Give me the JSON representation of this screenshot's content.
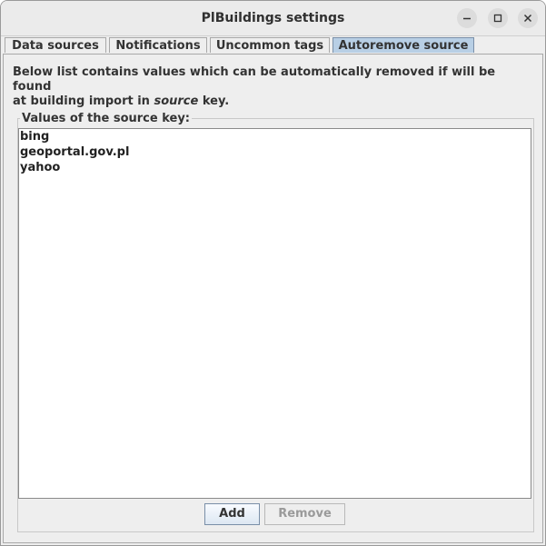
{
  "window": {
    "title": "PlBuildings settings"
  },
  "window_controls": {
    "minimize_icon": "minimize-icon",
    "maximize_icon": "maximize-icon",
    "close_icon": "close-icon"
  },
  "tabs": [
    {
      "label": "Data sources",
      "active": false
    },
    {
      "label": "Notifications",
      "active": false
    },
    {
      "label": "Uncommon tags",
      "active": false
    },
    {
      "label": "Autoremove source",
      "active": true
    }
  ],
  "panel": {
    "description_line1": "Below list contains values which can be automatically removed if will be found",
    "description_line2_prefix": "at building import in ",
    "description_line2_em": "source",
    "description_line2_suffix": " key.",
    "group_label": "Values of the source key:",
    "values": [
      "bing",
      "geoportal.gov.pl",
      "yahoo"
    ],
    "add_label": "Add",
    "remove_label": "Remove"
  },
  "colors": {
    "active_tab": "#b8cfe5",
    "disabled_text": "#9a9a9a"
  }
}
